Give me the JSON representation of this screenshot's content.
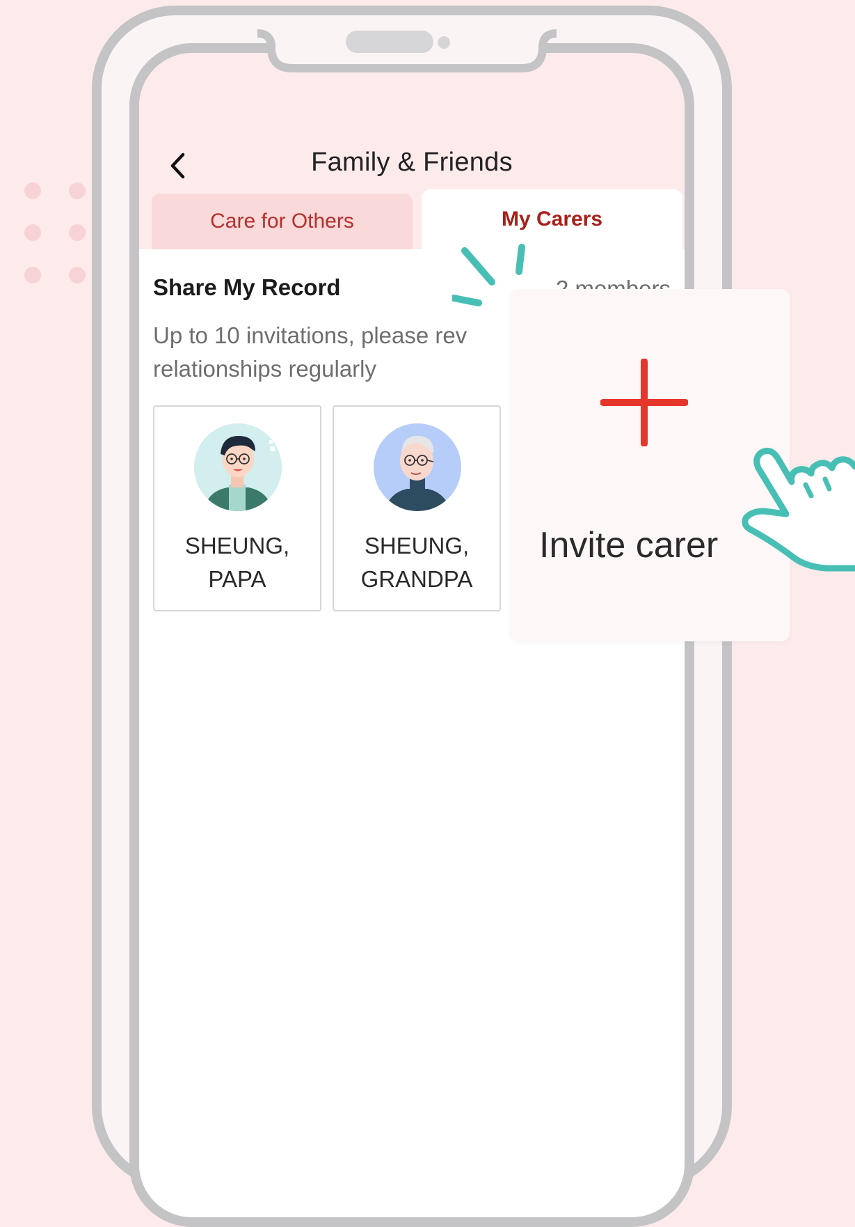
{
  "header": {
    "title": "Family & Friends",
    "back_icon": "chevron-left-icon"
  },
  "tabs": [
    {
      "label": "Care for Others",
      "active": false
    },
    {
      "label": "My Carers",
      "active": true
    }
  ],
  "section": {
    "title": "Share My Record",
    "member_count": "2 members",
    "description": "Up to 10 invitations, please rev\nrelationships regularly"
  },
  "carers": [
    {
      "name": "SHEUNG,\nPAPA",
      "avatar_icon": "young-man-avatar-icon"
    },
    {
      "name": "SHEUNG,\nGRANDPA",
      "avatar_icon": "elderly-man-avatar-icon"
    }
  ],
  "invite": {
    "label": "Invite carer",
    "icon": "plus-icon"
  },
  "colors": {
    "background": "#fdebec",
    "tab_inactive_bg": "#f9d9da",
    "tab_active_text": "#a8201a",
    "accent_red": "#e6352b",
    "teal": "#48bfb5",
    "phone_frame": "#c4c4c6"
  }
}
